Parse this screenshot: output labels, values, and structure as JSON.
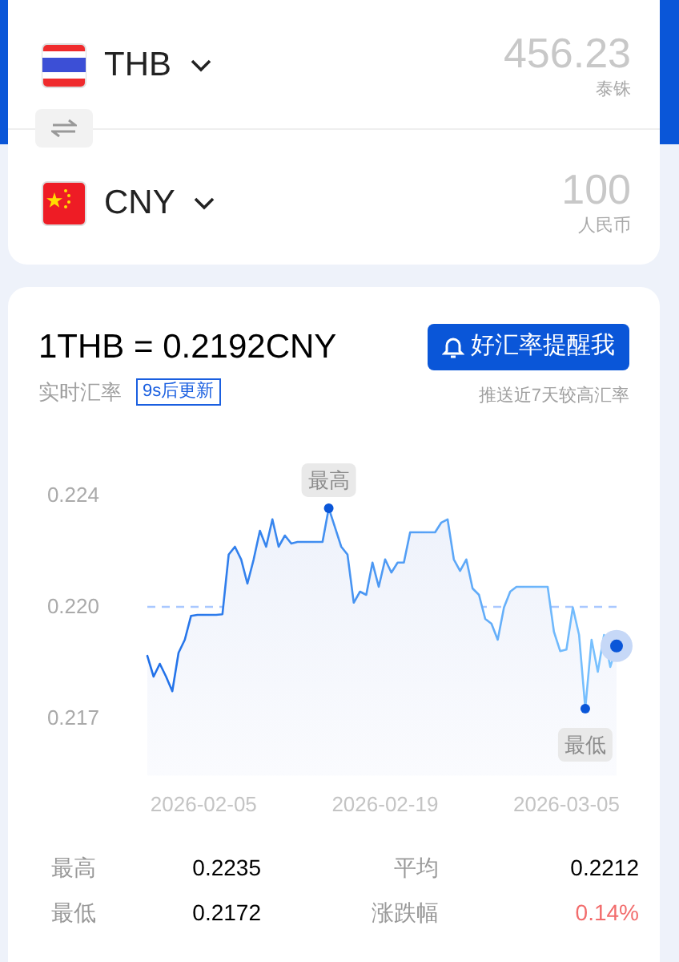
{
  "converter": {
    "rows": [
      {
        "code": "THB",
        "amount": "456.23",
        "name": "泰铢"
      },
      {
        "code": "CNY",
        "amount": "100",
        "name": "人民币"
      }
    ]
  },
  "rate": {
    "title": "1THB = 0.2192CNY",
    "label": "实时汇率",
    "badge": "9s后更新",
    "alert_button": "好汇率提醒我",
    "note": "推送近7天较高汇率"
  },
  "chart_data": {
    "type": "area",
    "ylim": [
      0.2169,
      0.2239
    ],
    "categories": [
      null,
      null,
      null,
      null,
      null,
      null,
      null,
      null,
      null,
      "2026-02-05",
      null,
      null,
      null,
      null,
      null,
      null,
      null,
      null,
      null,
      null,
      null,
      null,
      null,
      null,
      null,
      null,
      null,
      null,
      null,
      null,
      null,
      null,
      null,
      null,
      null,
      null,
      null,
      null,
      "2026-02-19",
      null,
      null,
      null,
      null,
      null,
      null,
      null,
      null,
      null,
      null,
      null,
      null,
      null,
      null,
      null,
      null,
      null,
      null,
      null,
      null,
      null,
      null,
      null,
      null,
      null,
      null,
      null,
      null,
      "2026-03-05",
      null,
      null,
      null,
      null,
      null,
      null,
      null,
      null
    ],
    "yticks": [
      {
        "value": 0.2239,
        "label": "0.224"
      },
      {
        "value": 0.2204,
        "label": "0.220"
      },
      {
        "value": 0.2169,
        "label": "0.217"
      }
    ],
    "series": [
      {
        "color": "#1f6fe8",
        "values": [
          0.21886,
          0.21821,
          0.21861,
          0.21821,
          0.21775,
          0.21896,
          0.21937,
          0.22012,
          0.22015,
          0.22015,
          0.22015,
          0.22015,
          0.22017,
          0.22204,
          0.22229,
          0.22189,
          0.22113,
          0.22189,
          0.22279,
          0.22229,
          0.22315,
          0.22229,
          0.22264,
          0.22239,
          0.22244,
          0.22244,
          0.22244,
          0.22244,
          0.22244,
          0.2235,
          0.2229,
          0.22229,
          0.22204,
          0.22053,
          0.22088,
          0.22078,
          0.22179,
          0.22103,
          0.22189,
          0.22148,
          0.22179,
          0.22179,
          0.22274,
          0.22274,
          0.22274,
          0.22274,
          0.22274,
          0.22305,
          0.22315,
          0.22189,
          0.22153,
          0.22189,
          0.22098,
          0.22078,
          0.22002,
          0.21987,
          0.21937,
          0.22038,
          0.22088,
          0.22103,
          0.22103,
          0.22103,
          0.22103,
          0.22103,
          0.22103,
          0.21962,
          0.21901,
          0.21906,
          0.22038,
          0.21952,
          0.2172,
          0.21937,
          0.21836,
          0.21952,
          0.21851,
          0.21917
        ]
      }
    ],
    "annotations": [
      {
        "text": "最高",
        "y": 0.2235
      },
      {
        "text": "最低",
        "y": 0.2172
      }
    ],
    "ref_lines": [
      {
        "axis": "y",
        "value": 0.2204
      }
    ]
  },
  "stats": [
    {
      "label": "最高",
      "value": "0.2235"
    },
    {
      "label": "平均",
      "value": "0.2212"
    },
    {
      "label": "最低",
      "value": "0.2172"
    },
    {
      "label": "涨跌幅",
      "value": "0.14%",
      "kind": "rise"
    }
  ]
}
